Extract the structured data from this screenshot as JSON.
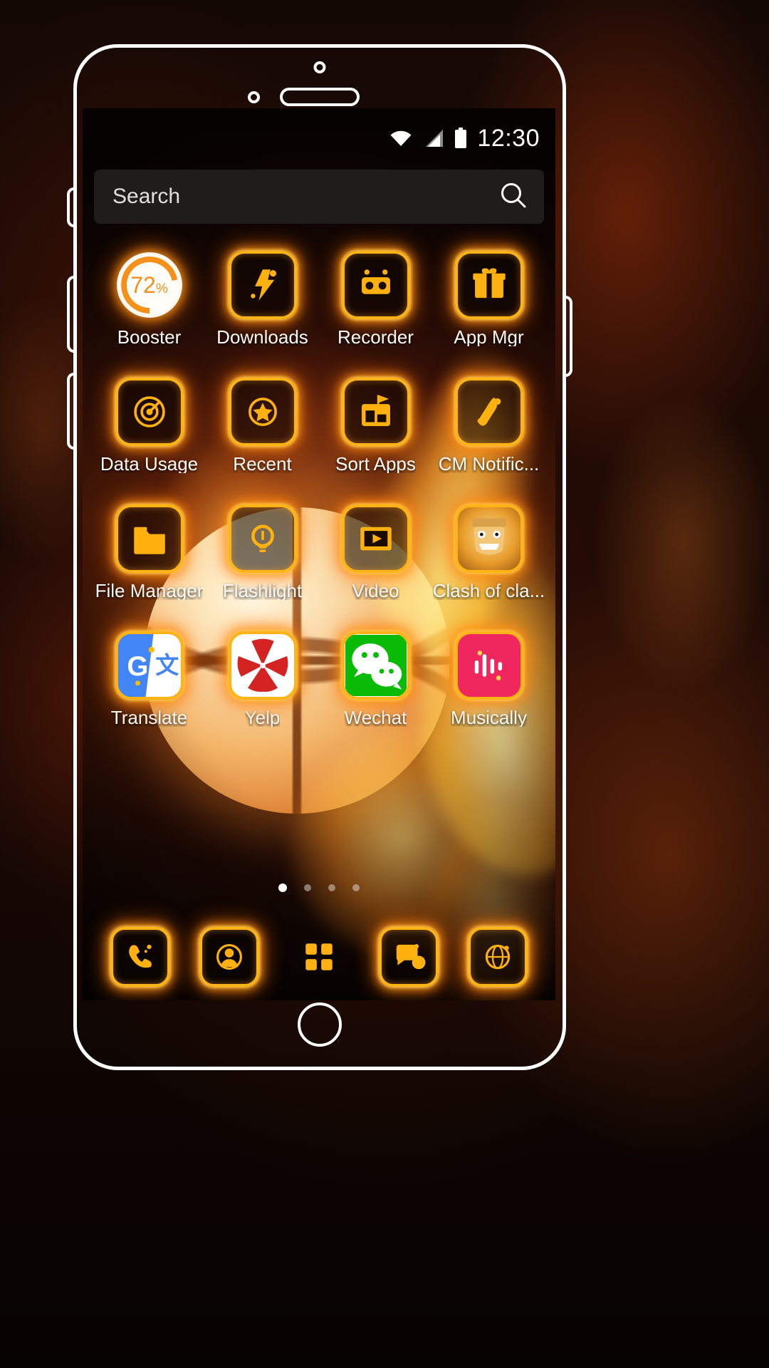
{
  "theme": {
    "name": "Flaming Basketball",
    "accent": "#ffb316",
    "glow": "#ff6e0a",
    "label_color": "#ffffff",
    "searchbar_bg": "#221e1d"
  },
  "status_bar": {
    "time": "12:30",
    "icons": [
      "wifi-icon",
      "signal-icon",
      "battery-icon"
    ]
  },
  "search": {
    "placeholder": "Search",
    "value": "",
    "icon": "search-icon"
  },
  "home_screen": {
    "apps": [
      {
        "label": "Booster",
        "icon": "booster-icon",
        "badge": "72",
        "badge_unit": "%"
      },
      {
        "label": "Downloads",
        "icon": "downloads-icon"
      },
      {
        "label": "Recorder",
        "icon": "recorder-icon"
      },
      {
        "label": "App Mgr",
        "icon": "app-manager-icon"
      },
      {
        "label": "Data Usage",
        "icon": "data-usage-icon"
      },
      {
        "label": "Recent",
        "icon": "recent-star-icon"
      },
      {
        "label": "Sort Apps",
        "icon": "sort-apps-icon"
      },
      {
        "label": "CM Notific...",
        "icon": "cm-notification-icon"
      },
      {
        "label": "File Manager",
        "icon": "file-manager-icon"
      },
      {
        "label": "Flashlight",
        "icon": "flashlight-icon"
      },
      {
        "label": "Video",
        "icon": "video-icon"
      },
      {
        "label": "Clash of cla...",
        "icon": "clash-of-clans-icon"
      },
      {
        "label": "Translate",
        "icon": "google-translate-icon"
      },
      {
        "label": "Yelp",
        "icon": "yelp-icon"
      },
      {
        "label": "Wechat",
        "icon": "wechat-icon"
      },
      {
        "label": "Musically",
        "icon": "musically-icon"
      }
    ]
  },
  "page_indicator": {
    "total": 4,
    "current": 1
  },
  "dock": {
    "items": [
      {
        "name": "phone",
        "icon": "phone-icon"
      },
      {
        "name": "contacts",
        "icon": "contacts-icon"
      },
      {
        "name": "app-drawer",
        "icon": "app-drawer-icon"
      },
      {
        "name": "messages",
        "icon": "messages-icon"
      },
      {
        "name": "browser",
        "icon": "browser-icon"
      }
    ]
  }
}
